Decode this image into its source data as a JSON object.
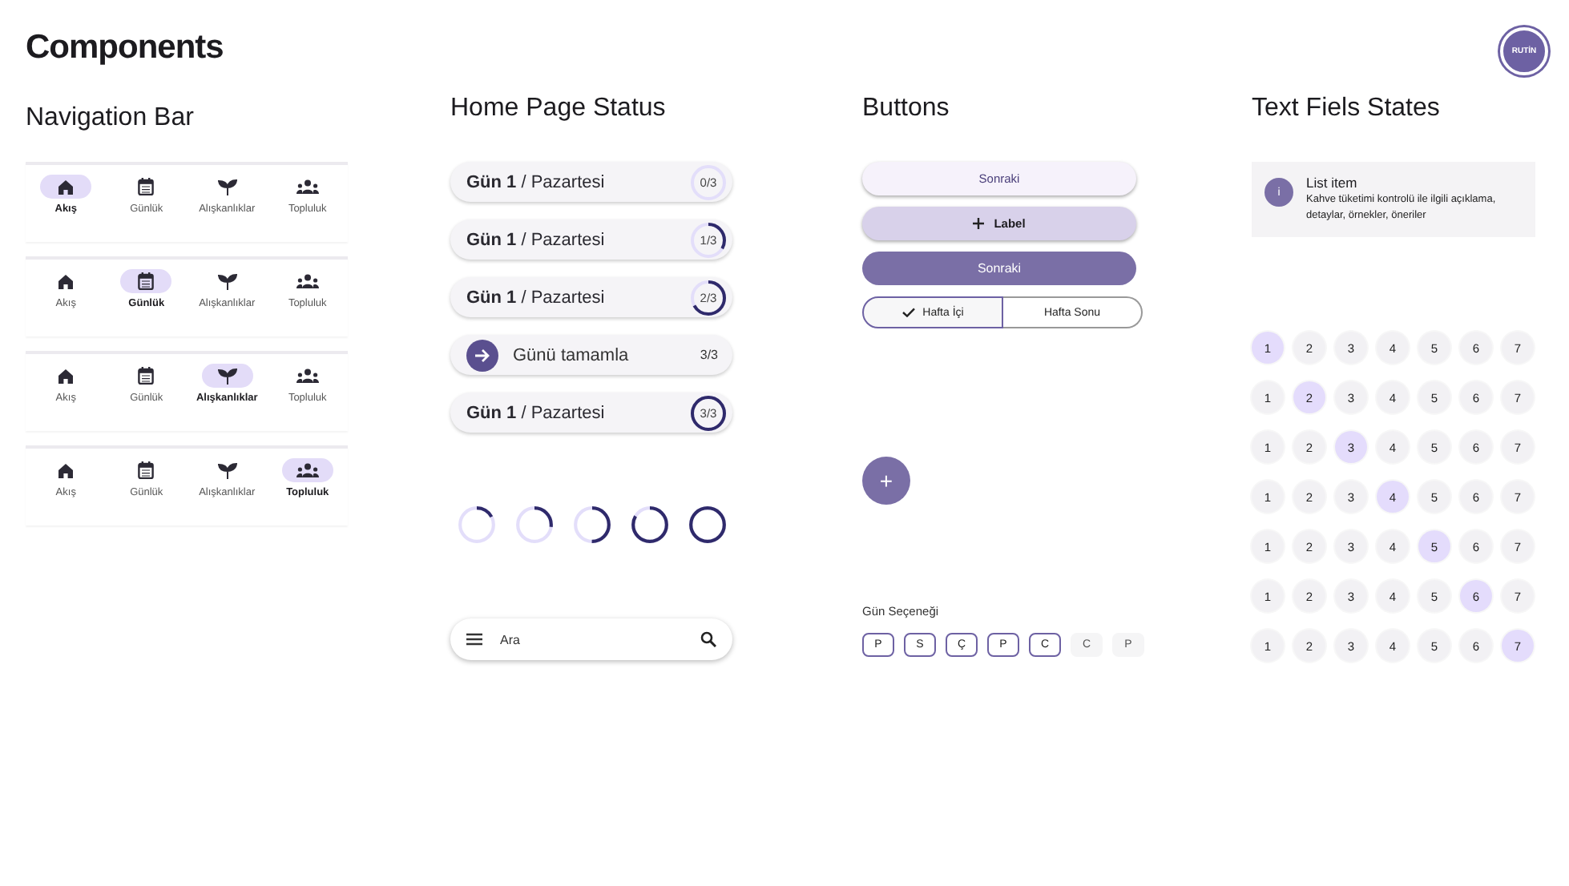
{
  "title": "Components",
  "logo": "RUTİN",
  "navigation": {
    "title": "Navigation Bar",
    "bars": [
      {
        "items": [
          {
            "label": "Akış",
            "selected": true
          },
          {
            "label": "Günlük",
            "selected": false
          },
          {
            "label": "Alışkanlıklar",
            "selected": false
          },
          {
            "label": "Topluluk",
            "selected": false
          }
        ]
      },
      {
        "items": [
          {
            "label": "Akış",
            "selected": false
          },
          {
            "label": "Günlük",
            "selected": true
          },
          {
            "label": "Alışkanlıklar",
            "selected": false
          },
          {
            "label": "Topluluk",
            "selected": false
          }
        ]
      },
      {
        "items": [
          {
            "label": "Akış",
            "selected": false
          },
          {
            "label": "Günlük",
            "selected": false
          },
          {
            "label": "Alışkanlıklar",
            "selected": true
          },
          {
            "label": "Topluluk",
            "selected": false
          }
        ]
      },
      {
        "items": [
          {
            "label": "Akış",
            "selected": false
          },
          {
            "label": "Günlük",
            "selected": false
          },
          {
            "label": "Alışkanlıklar",
            "selected": false
          },
          {
            "label": "Topluluk",
            "selected": true
          }
        ]
      }
    ]
  },
  "home_status": {
    "title": "Home Page Status",
    "rows": [
      {
        "kind": "day",
        "text": "**Gün 1** / Pazartesi",
        "reading": "0/3",
        "level": 0
      },
      {
        "kind": "day",
        "text": "**Gün 1** / Pazartesi",
        "reading": "1/3",
        "level": 0.333
      },
      {
        "kind": "day",
        "text": "**Gün 1** / Pazartesi",
        "reading": "2/3",
        "level": 0.667
      },
      {
        "kind": "complete",
        "text": "Günü tamamla",
        "reading": "3/3"
      },
      {
        "kind": "day",
        "text": "**Gün 1** / Pazartesi",
        "reading": "3/3",
        "level": 1
      }
    ],
    "rings": [
      {
        "level": 0.17
      },
      {
        "level": 0.27
      },
      {
        "level": 0.5
      },
      {
        "level": 0.83
      },
      {
        "level": 1
      }
    ],
    "search": {
      "placeholder": "Ara"
    }
  },
  "buttons": {
    "title": "Buttons",
    "items": [
      {
        "kind": "light",
        "label": "Sonraki"
      },
      {
        "kind": "tonal",
        "label": "Label"
      },
      {
        "kind": "filled",
        "label": "Sonraki"
      }
    ],
    "segments": [
      {
        "label": "Hafta İçi",
        "selected": true
      },
      {
        "label": "Hafta Sonu",
        "selected": false
      }
    ],
    "fab": "+",
    "day_picker": {
      "label": "Gün Seçeneği",
      "days": [
        {
          "label": "P",
          "selected": true
        },
        {
          "label": "S",
          "selected": true
        },
        {
          "label": "Ç",
          "selected": true
        },
        {
          "label": "P",
          "selected": true
        },
        {
          "label": "C",
          "selected": true
        },
        {
          "label": "C",
          "selected": false
        },
        {
          "label": "P",
          "selected": false
        }
      ]
    }
  },
  "text_fields": {
    "title": "Text Fiels States",
    "list_item": {
      "avatar": "i",
      "title": "List item",
      "description": "Kahve tüketimi kontrolü ile ilgili açıklama, detaylar, örnekler, öneriler"
    },
    "rows": [
      {
        "cells": [
          {
            "label": "1",
            "selected": true
          },
          {
            "label": "2",
            "selected": false
          },
          {
            "label": "3",
            "selected": false
          },
          {
            "label": "4",
            "selected": false
          },
          {
            "label": "5",
            "selected": false
          },
          {
            "label": "6",
            "selected": false
          },
          {
            "label": "7",
            "selected": false
          }
        ]
      },
      {
        "cells": [
          {
            "label": "1",
            "selected": false
          },
          {
            "label": "2",
            "selected": true
          },
          {
            "label": "3",
            "selected": false
          },
          {
            "label": "4",
            "selected": false
          },
          {
            "label": "5",
            "selected": false
          },
          {
            "label": "6",
            "selected": false
          },
          {
            "label": "7",
            "selected": false
          }
        ]
      },
      {
        "cells": [
          {
            "label": "1",
            "selected": false
          },
          {
            "label": "2",
            "selected": false
          },
          {
            "label": "3",
            "selected": true
          },
          {
            "label": "4",
            "selected": false
          },
          {
            "label": "5",
            "selected": false
          },
          {
            "label": "6",
            "selected": false
          },
          {
            "label": "7",
            "selected": false
          }
        ]
      },
      {
        "cells": [
          {
            "label": "1",
            "selected": false
          },
          {
            "label": "2",
            "selected": false
          },
          {
            "label": "3",
            "selected": false
          },
          {
            "label": "4",
            "selected": true
          },
          {
            "label": "5",
            "selected": false
          },
          {
            "label": "6",
            "selected": false
          },
          {
            "label": "7",
            "selected": false
          }
        ]
      },
      {
        "cells": [
          {
            "label": "1",
            "selected": false
          },
          {
            "label": "2",
            "selected": false
          },
          {
            "label": "3",
            "selected": false
          },
          {
            "label": "4",
            "selected": false
          },
          {
            "label": "5",
            "selected": true
          },
          {
            "label": "6",
            "selected": false
          },
          {
            "label": "7",
            "selected": false
          }
        ]
      },
      {
        "cells": [
          {
            "label": "1",
            "selected": false
          },
          {
            "label": "2",
            "selected": false
          },
          {
            "label": "3",
            "selected": false
          },
          {
            "label": "4",
            "selected": false
          },
          {
            "label": "5",
            "selected": false
          },
          {
            "label": "6",
            "selected": true
          },
          {
            "label": "7",
            "selected": false
          }
        ]
      },
      {
        "cells": [
          {
            "label": "1",
            "selected": false
          },
          {
            "label": "2",
            "selected": false
          },
          {
            "label": "3",
            "selected": false
          },
          {
            "label": "4",
            "selected": false
          },
          {
            "label": "5",
            "selected": false
          },
          {
            "label": "6",
            "selected": false
          },
          {
            "label": "7",
            "selected": true
          }
        ]
      }
    ]
  }
}
